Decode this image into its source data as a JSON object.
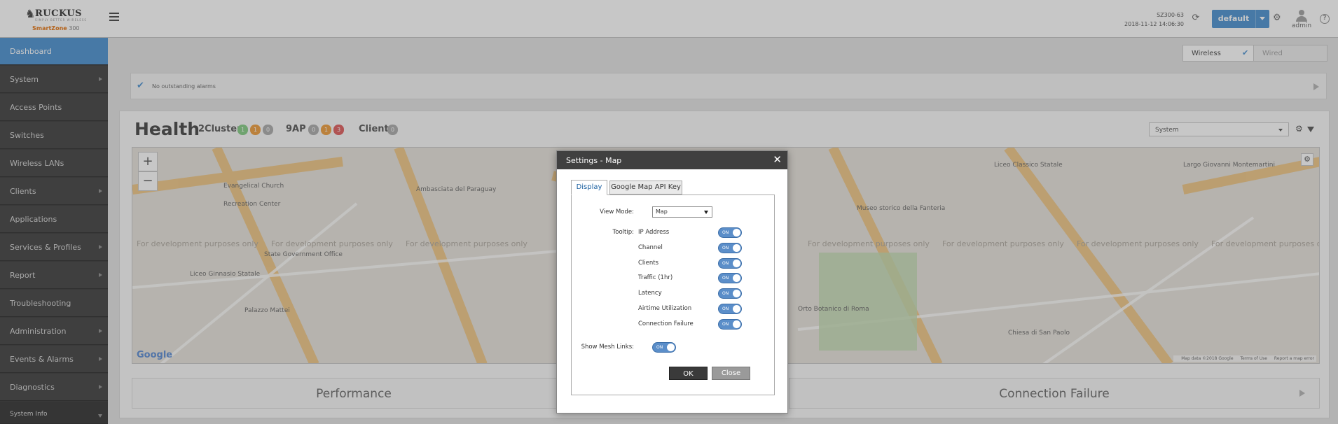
{
  "header": {
    "logo_brand": "RUCKUS",
    "logo_tagline": "SIMPLY BETTER WIRELESS",
    "product_name": "SmartZone",
    "product_model": "300",
    "controller_name": "SZ300-63",
    "datetime": "2018-11-12  14:06:30",
    "domain_label": "default",
    "user_label": "admin"
  },
  "sidebar": {
    "items": [
      {
        "label": "Dashboard"
      },
      {
        "label": "System"
      },
      {
        "label": "Access Points"
      },
      {
        "label": "Switches"
      },
      {
        "label": "Wireless LANs"
      },
      {
        "label": "Clients"
      },
      {
        "label": "Applications"
      },
      {
        "label": "Services & Profiles"
      },
      {
        "label": "Report"
      },
      {
        "label": "Troubleshooting"
      },
      {
        "label": "Administration"
      },
      {
        "label": "Events & Alarms"
      },
      {
        "label": "Diagnostics"
      }
    ],
    "footer_label": "System Info"
  },
  "toggle_group": {
    "wireless": "Wireless",
    "wired": "Wired"
  },
  "alarms": {
    "text": "No outstanding alarms"
  },
  "health": {
    "title": "Health",
    "cluster_label": "2Cluster",
    "cluster_badges": [
      "1",
      "1",
      "0"
    ],
    "ap_label": "9AP",
    "ap_badges": [
      "0",
      "1",
      "3"
    ],
    "client_label": "Client",
    "client_badges": [
      "0"
    ],
    "filter_selected": "System"
  },
  "map": {
    "watermark": "For development purposes only",
    "places": [
      "Evangelical Church",
      "Recreation Center",
      "Ambasciata del Paraguay",
      "State Government Office",
      "Liceo Ginnasio Statale",
      "Palazzo Mattei",
      "Orto Botanico di Roma",
      "Museo storico della Fanteria",
      "Liceo Classico Statale",
      "Chiesa di San Paolo",
      "Largo Giovanni Montemartini"
    ],
    "google": "Google",
    "footer": [
      "Map data ©2018 Google",
      "Terms of Use",
      "Report a map error"
    ]
  },
  "cards": {
    "performance": "Performance",
    "connection_failure": "Connection Failure"
  },
  "dialog": {
    "title": "Settings - Map",
    "tabs": [
      "Display",
      "Google Map API Key"
    ],
    "view_mode_label": "View Mode:",
    "view_mode_value": "Map",
    "tooltip_label": "Tooltip:",
    "tooltip_options": [
      {
        "label": "IP Address",
        "state": "ON"
      },
      {
        "label": "Channel",
        "state": "ON"
      },
      {
        "label": "Clients",
        "state": "ON"
      },
      {
        "label": "Traffic (1hr)",
        "state": "ON"
      },
      {
        "label": "Latency",
        "state": "ON"
      },
      {
        "label": "Airtime Utilization",
        "state": "ON"
      },
      {
        "label": "Connection Failure",
        "state": "ON"
      }
    ],
    "mesh_label": "Show Mesh Links:",
    "mesh_state": "ON",
    "ok_label": "OK",
    "close_label": "Close"
  }
}
